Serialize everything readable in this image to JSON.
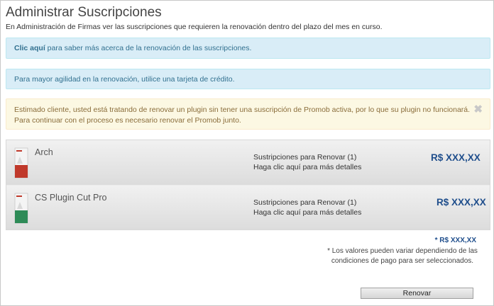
{
  "header": {
    "title": "Administrar Suscripciones",
    "subtitle": "En Administración de Firmas ver las suscripciones que requieren la renovación dentro del plazo del mes en curso."
  },
  "alerts": {
    "info1_link": "Clic aquí",
    "info1_text": " para saber más acerca de la renovación de las suscripciones.",
    "info2_text": "Para mayor agilidad en la renovación, utilice una tarjeta de crédito.",
    "warning_line1": "Estimado cliente, usted está tratando de renovar un plugin sin tener una suscripción de Promob activa, por lo que su plugin no funcionará.",
    "warning_line2": "Para continuar con el proceso es necesario renovar el Promob junto.",
    "close_symbol": "✖"
  },
  "products": [
    {
      "name": "Arch",
      "renew_count": "Sustripciones para Renovar (1)",
      "details": "Haga clic aquí para más detalles",
      "price": "R$  XXX,XX",
      "icon": "product-box-icon",
      "accent": "#c0392b"
    },
    {
      "name": "CS Plugin Cut Pro",
      "renew_count": "Sustripciones para Renovar (1)",
      "details": "Haga clic aquí para más detalles",
      "price": "R$  XXX,XX",
      "icon": "product-box-icon",
      "accent": "#2e8b57"
    }
  ],
  "footer": {
    "total_price": "* R$  XXX,XX",
    "note": "* Los valores pueden variar dependiendo de las condiciones de pago para ser seleccionados.",
    "renew_button": "Renovar"
  }
}
